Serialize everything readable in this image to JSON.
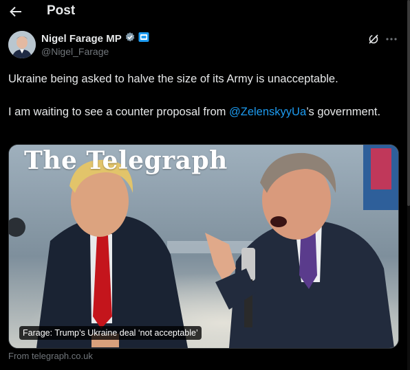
{
  "header": {
    "title": "Post",
    "back_icon": "arrow-left-icon"
  },
  "author": {
    "display_name": "Nigel Farage MP",
    "handle": "@Nigel_Farage",
    "badges": [
      "verified-badge-icon",
      "government-label-icon"
    ],
    "verified_color": "#71767b"
  },
  "actions": {
    "grok_icon": "grok-icon",
    "more_icon": "more-dots-icon"
  },
  "tweet": {
    "line1": "Ukraine being asked to halve the size of its Army is unacceptable.",
    "line2_prefix": "I am waiting to see a counter proposal from ",
    "mention": "@ZelenskyyUa",
    "line2_suffix": "’s government."
  },
  "media": {
    "logo_text": "The Telegraph",
    "caption": "Farage: Trump’s Ukraine deal ‘not acceptable’"
  },
  "link_source": "From telegraph.co.uk",
  "colors": {
    "background": "#000000",
    "text": "#e7e9ea",
    "secondary": "#71767b",
    "link": "#1d9bf0"
  }
}
